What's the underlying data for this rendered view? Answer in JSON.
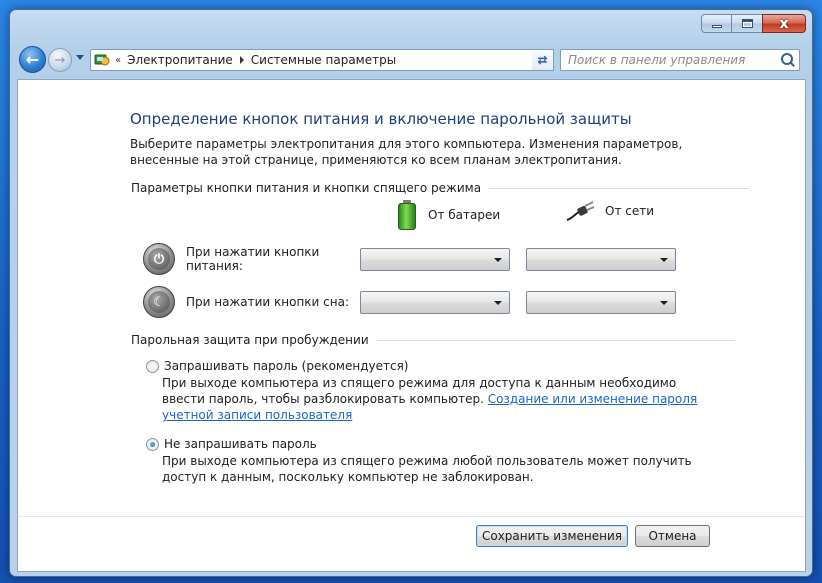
{
  "window": {
    "caption": {
      "minimize": "",
      "maximize": "",
      "close": "x"
    }
  },
  "navbar": {
    "breadcrumb": [
      "Электропитание",
      "Системные параметры"
    ],
    "search_placeholder": "Поиск в панели управления"
  },
  "main": {
    "title": "Определение кнопок питания и включение парольной защиты",
    "description": "Выберите параметры электропитания для этого компьютера. Изменения параметров, внесенные на этой странице, применяются ко всем планам электропитания.",
    "power_section": {
      "header": "Параметры кнопки питания и кнопки спящего режима",
      "col_battery": "От батареи",
      "col_ac": "От сети",
      "rows": [
        {
          "label": "При нажатии кнопки питания:",
          "battery_value": "",
          "ac_value": ""
        },
        {
          "label": "При нажатии кнопки сна:",
          "battery_value": "",
          "ac_value": ""
        }
      ]
    },
    "password_section": {
      "header": "Парольная защита при пробуждении",
      "options": [
        {
          "label": "Запрашивать пароль (рекомендуется)",
          "checked": false,
          "description": "При выходе компьютера из спящего режима для доступа к данным необходимо ввести пароль, чтобы разблокировать компьютер.",
          "link": "Создание или изменение пароля учетной записи пользователя"
        },
        {
          "label": "Не запрашивать пароль",
          "checked": true,
          "description": "При выходе компьютера из спящего режима любой пользователь может получить доступ к данным, поскольку компьютер не заблокирован."
        }
      ]
    }
  },
  "footer": {
    "save_label": "Сохранить изменения",
    "cancel_label": "Отмена"
  }
}
